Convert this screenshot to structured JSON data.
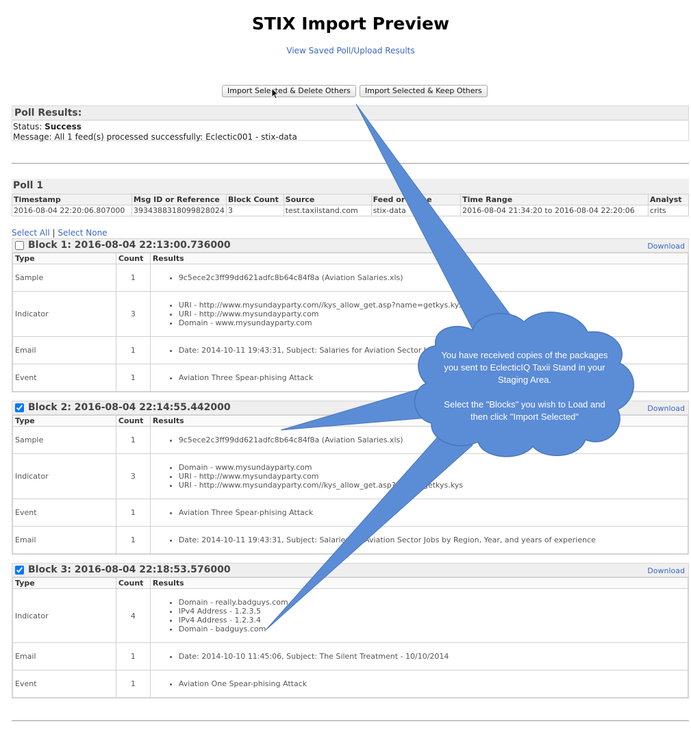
{
  "page": {
    "title": "STIX Import Preview",
    "saved_link": "View Saved Poll/Upload Results"
  },
  "actions": {
    "import_delete": "Import Selected & Delete Others",
    "import_keep": "Import Selected & Keep Others"
  },
  "poll_results": {
    "heading": "Poll Results:",
    "status_label": "Status:",
    "status_value": "Success",
    "message_label": "Message:",
    "message_value": "All 1 feed(s) processed successfully: Eclectic001 - stix-data"
  },
  "poll1": {
    "heading": "Poll 1",
    "columns": [
      "Timestamp",
      "Msg ID or Reference",
      "Block Count",
      "Source",
      "Feed or Name",
      "Time Range",
      "Analyst"
    ],
    "row": [
      "2016-08-04 22:20:06.807000",
      "3934388318099828024",
      "3",
      "test.taxiistand.com",
      "stix-data",
      "2016-08-04 21:34:20 to 2016-08-04 22:20:06",
      "crits"
    ]
  },
  "select": {
    "all": "Select All",
    "separator": "|",
    "none": "Select None"
  },
  "result_columns": {
    "type": "Type",
    "count": "Count",
    "results": "Results"
  },
  "blocks": [
    {
      "title": "Block 1: 2016-08-04 22:13:00.736000",
      "checked": false,
      "download": "Download",
      "rows": [
        {
          "type": "Sample",
          "count": "1",
          "results": [
            "9c5ece2c3ff99dd621adfc8b64c84f8a (Aviation Salaries.xls)"
          ]
        },
        {
          "type": "Indicator",
          "count": "3",
          "results": [
            "URI - http://www.mysundayparty.com//kys_allow_get.asp?name=getkys.kys",
            "URI - http://www.mysundayparty.com",
            "Domain - www.mysundayparty.com"
          ]
        },
        {
          "type": "Email",
          "count": "1",
          "results": [
            "Date: 2014-10-11 19:43:31, Subject: Salaries for Aviation Sector Jobs by Region, Year, and years of experience"
          ]
        },
        {
          "type": "Event",
          "count": "1",
          "results": [
            "Aviation Three Spear-phising Attack"
          ]
        }
      ]
    },
    {
      "title": "Block 2: 2016-08-04 22:14:55.442000",
      "checked": true,
      "download": "Download",
      "rows": [
        {
          "type": "Sample",
          "count": "1",
          "results": [
            "9c5ece2c3ff99dd621adfc8b64c84f8a (Aviation Salaries.xls)"
          ]
        },
        {
          "type": "Indicator",
          "count": "3",
          "results": [
            "Domain - www.mysundayparty.com",
            "URI - http://www.mysundayparty.com",
            "URI - http://www.mysundayparty.com//kys_allow_get.asp?name=getkys.kys"
          ]
        },
        {
          "type": "Event",
          "count": "1",
          "results": [
            "Aviation Three Spear-phising Attack"
          ]
        },
        {
          "type": "Email",
          "count": "1",
          "results": [
            "Date: 2014-10-11 19:43:31, Subject: Salaries for Aviation Sector Jobs by Region, Year, and years of experience"
          ]
        }
      ]
    },
    {
      "title": "Block 3: 2016-08-04 22:18:53.576000",
      "checked": true,
      "download": "Download",
      "rows": [
        {
          "type": "Indicator",
          "count": "4",
          "results": [
            "Domain - really.badguys.com",
            "IPv4 Address - 1.2.3.5",
            "IPv4 Address - 1.2.3.4",
            "Domain - badguys.com"
          ]
        },
        {
          "type": "Email",
          "count": "1",
          "results": [
            "Date: 2014-10-10 11:45:06, Subject: The Silent Treatment - 10/10/2014"
          ]
        },
        {
          "type": "Event",
          "count": "1",
          "results": [
            "Aviation One Spear-phising Attack"
          ]
        }
      ]
    }
  ],
  "callout": {
    "line1": "You have received copies of the packages you sent to EclecticIQ Taxii Stand in your Staging Area.",
    "line2": "Select the \"Blocks\" you wish to Load and then click \"Import Selected\"",
    "color": "#5b8cd6"
  }
}
